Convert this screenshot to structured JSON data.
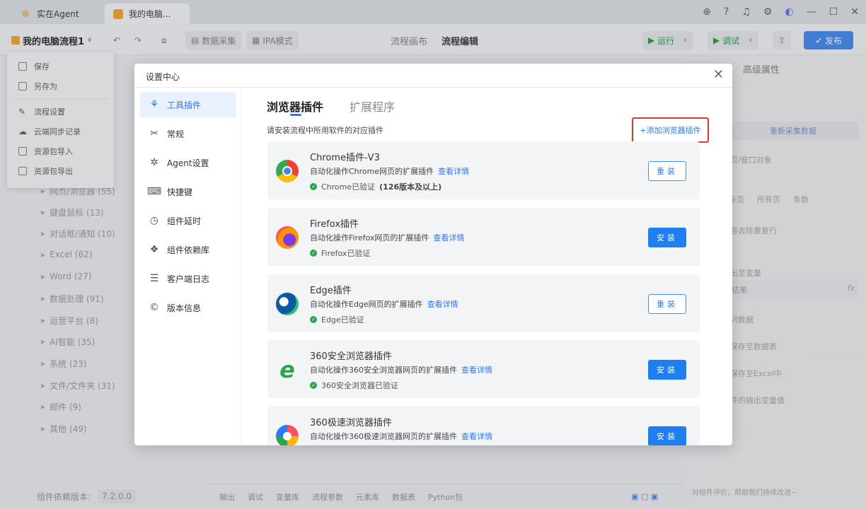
{
  "window": {
    "tabs": [
      {
        "label": "实在Agent"
      },
      {
        "label": "我的电脑..."
      }
    ]
  },
  "toolbar": {
    "project_name": "我的电脑流程1",
    "data_collect": "数据采集",
    "ipa_mode": "IPA模式",
    "canvas_tab": "流程画布",
    "edit_tab": "流程编辑",
    "run": "运行",
    "debug": "调试",
    "publish": "发布"
  },
  "menu": {
    "items": [
      "保存",
      "另存为",
      "流程设置",
      "云端同步记录",
      "资源包导入",
      "资源包导出"
    ]
  },
  "left_tree": {
    "items": [
      "网页/浏览器 (55)",
      "键盘鼠标 (13)",
      "对话框/通知 (10)",
      "Excel (62)",
      "Word (27)",
      "数据处理 (91)",
      "运营平台 (8)",
      "AI智能 (35)",
      "系统 (23)",
      "文件/文件夹 (31)",
      "邮件 (9)",
      "其他 (49)"
    ],
    "version_label": "组件依赖版本:",
    "version_value": "7.2.0.0"
  },
  "bottom_tabs": [
    "输出",
    "调试",
    "变量库",
    "流程参数",
    "元素库",
    "数据表",
    "Python包"
  ],
  "right_panel": {
    "title": "高级属性",
    "recollect": "重新采集数据",
    "window_obj": "页/窗口对象",
    "pager": [
      "多页",
      "所有页",
      "条数"
    ],
    "dedupe": "容去除重复行",
    "output_var": "出至变量",
    "result": "结果",
    "fx": "fx",
    "data": "列数据",
    "save_table": "保存至数据表",
    "save_excel": "保存至Excel中",
    "out_var_value": "件的输出变量值",
    "feedback": "对组件评价，帮助我们持续改进~"
  },
  "dialog": {
    "title": "设置中心",
    "sidebar": [
      {
        "label": "工具插件",
        "icon": "puzzle-icon"
      },
      {
        "label": "常规",
        "icon": "tools-icon"
      },
      {
        "label": "Agent设置",
        "icon": "gear-icon"
      },
      {
        "label": "快捷键",
        "icon": "keyboard-icon"
      },
      {
        "label": "组件延时",
        "icon": "clock-icon"
      },
      {
        "label": "组件依赖库",
        "icon": "layers-icon"
      },
      {
        "label": "客户端日志",
        "icon": "log-icon"
      },
      {
        "label": "版本信息",
        "icon": "copyright-icon"
      }
    ],
    "tabs": [
      "浏览器插件",
      "扩展程序"
    ],
    "hint": "请安装流程中所用软件的对应插件",
    "add_link": "+添加浏览器插件",
    "plugins": [
      {
        "name": "Chrome插件-V3",
        "desc": "自动化操作Chrome网页的扩展插件",
        "link": "查看详情",
        "verified": "Chrome已验证",
        "note": "(126版本及以上)",
        "button": "重装"
      },
      {
        "name": "Firefox插件",
        "desc": "自动化操作Firefox网页的扩展插件",
        "link": "查看详情",
        "verified": "Firefox已验证",
        "note": "",
        "button": "安装"
      },
      {
        "name": "Edge插件",
        "desc": "自动化操作Edge网页的扩展插件",
        "link": "查看详情",
        "verified": "Edge已验证",
        "note": "",
        "button": "重装"
      },
      {
        "name": "360安全浏览器插件",
        "desc": "自动化操作360安全浏览器网页的扩展插件",
        "link": "查看详情",
        "verified": "360安全浏览器已验证",
        "note": "",
        "button": "安装"
      },
      {
        "name": "360极速浏览器插件",
        "desc": "自动化操作360极速浏览器网页的扩展插件",
        "link": "查看详情",
        "verified": "",
        "note": "",
        "button": "安装"
      }
    ]
  }
}
